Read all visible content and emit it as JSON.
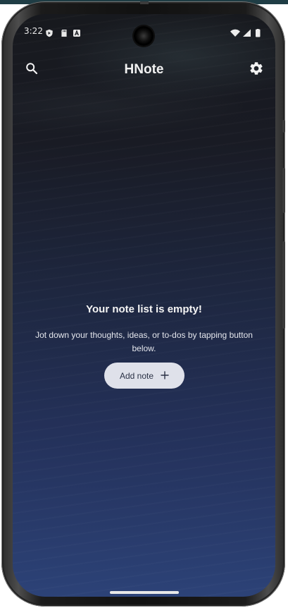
{
  "status_bar": {
    "time": "3:22",
    "icons_left": [
      "shield-icon",
      "sd-card-icon",
      "text-a-icon"
    ],
    "icons_right": [
      "wifi-icon",
      "signal-icon",
      "battery-icon"
    ]
  },
  "app_bar": {
    "title": "HNote",
    "search_icon": "search-icon",
    "settings_icon": "gear-icon"
  },
  "empty_state": {
    "title": "Your note list is empty!",
    "description": "Jot down your thoughts, ideas, or to-dos by tapping button below.",
    "button_label": "Add note",
    "button_icon": "plus-icon"
  },
  "colors": {
    "background_top": "#17191e",
    "background_bottom": "#2c4277",
    "button_bg": "#dfe1ea",
    "button_text": "#2a3145",
    "text_primary": "#f4f4f4"
  }
}
